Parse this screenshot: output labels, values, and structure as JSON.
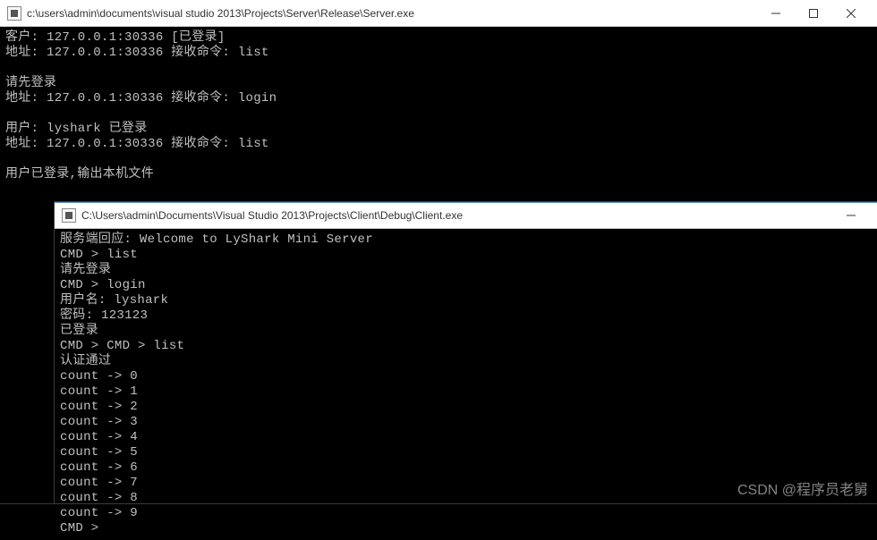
{
  "server": {
    "title": "c:\\users\\admin\\documents\\visual studio 2013\\Projects\\Server\\Release\\Server.exe",
    "lines": [
      "客户: 127.0.0.1:30336 [已登录]",
      "地址: 127.0.0.1:30336 接收命令: list",
      "",
      "请先登录",
      "地址: 127.0.0.1:30336 接收命令: login",
      "",
      "用户: lyshark 已登录",
      "地址: 127.0.0.1:30336 接收命令: list",
      "",
      "用户已登录,输出本机文件"
    ]
  },
  "client": {
    "title": "C:\\Users\\admin\\Documents\\Visual Studio 2013\\Projects\\Client\\Debug\\Client.exe",
    "lines": [
      "服务端回应: Welcome to LyShark Mini Server",
      "CMD > list",
      "请先登录",
      "CMD > login",
      "用户名: lyshark",
      "密码: 123123",
      "已登录",
      "CMD > CMD > list",
      "认证通过",
      "count -> 0",
      "count -> 1",
      "count -> 2",
      "count -> 3",
      "count -> 4",
      "count -> 5",
      "count -> 6",
      "count -> 7",
      "count -> 8",
      "count -> 9",
      "CMD >"
    ]
  },
  "watermark": "CSDN @程序员老舅"
}
